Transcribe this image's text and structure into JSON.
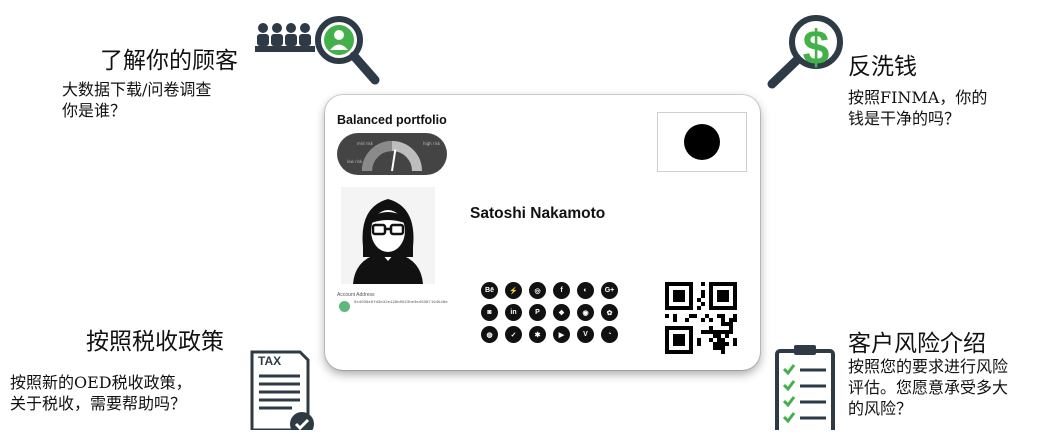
{
  "sections": {
    "kyc": {
      "title": "了解你的顾客",
      "text": "大数据下载/问卷调查\n你是谁？"
    },
    "aml": {
      "title": "反洗钱",
      "text": "按照FINMA，你的\n钱是干净的吗？"
    },
    "tax": {
      "title": "按照税收政策",
      "text": "按照新的OED税收政策，\n关于税收，需要帮助吗？",
      "icon_label": "TAX"
    },
    "risk": {
      "title": "客户风险介绍",
      "text": "按照您的要求进行风险\n评估。您愿意承受多大\n的风险？"
    }
  },
  "card": {
    "title": "Balanced portfolio",
    "name": "Satoshi Nakamoto",
    "gauge": {
      "low": "low risk",
      "high": "high risk",
      "mid": "mid risk",
      "level": 0.55
    },
    "account_label": "Account Address",
    "account_value": "0x4039e9fd3b32e128b0023be3e46387194b48e",
    "social_icons": [
      "Bē",
      "⚡",
      "◎",
      "f",
      "◐",
      "G+",
      "◙",
      "in",
      "P",
      "❖",
      "◉",
      "✿",
      "◍",
      "✓",
      "✱",
      "▶",
      "V",
      "◔"
    ]
  },
  "colors": {
    "accent_green": "#43b04a",
    "icon_dark": "#2e3b46",
    "card_border": "#d8d8d8"
  }
}
